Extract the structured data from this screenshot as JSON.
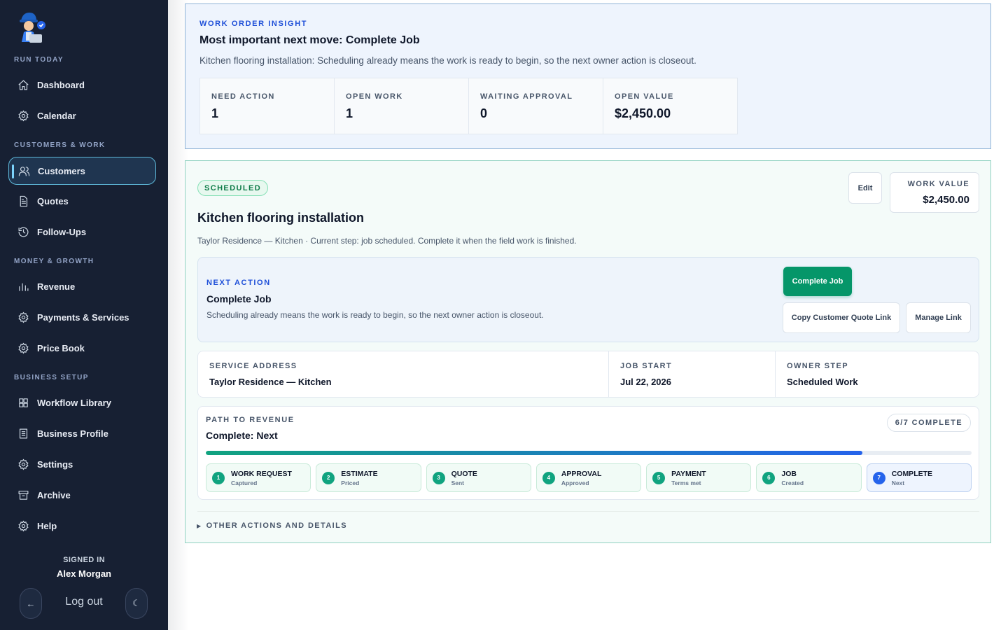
{
  "sidebar": {
    "sections": {
      "run_today": "RUN TODAY",
      "customers_work": "CUSTOMERS & WORK",
      "money_growth": "MONEY & GROWTH",
      "business_setup": "BUSINESS SETUP"
    },
    "items": [
      {
        "label": "Dashboard",
        "icon": "home-icon"
      },
      {
        "label": "Calendar",
        "icon": "gear-icon"
      },
      {
        "label": "Customers",
        "icon": "users-icon",
        "active": true
      },
      {
        "label": "Quotes",
        "icon": "document-icon"
      },
      {
        "label": "Follow-Ups",
        "icon": "history-icon"
      },
      {
        "label": "Revenue",
        "icon": "bar-chart-icon"
      },
      {
        "label": "Payments & Services",
        "icon": "gear-icon"
      },
      {
        "label": "Price Book",
        "icon": "gear-icon"
      },
      {
        "label": "Workflow Library",
        "icon": "grid-icon"
      },
      {
        "label": "Business Profile",
        "icon": "building-icon"
      },
      {
        "label": "Settings",
        "icon": "gear-icon"
      },
      {
        "label": "Archive",
        "icon": "archive-icon"
      },
      {
        "label": "Help",
        "icon": "gear-icon"
      }
    ],
    "signed_in_label": "SIGNED IN",
    "user_name": "Alex Morgan",
    "logout_label": "Log out",
    "back_icon": "←",
    "theme_icon": "☾"
  },
  "insight": {
    "eyebrow": "WORK ORDER INSIGHT",
    "headline": "Most important next move: Complete Job",
    "description": "Kitchen flooring installation: Scheduling already means the work is ready to begin, so the next owner action is closeout.",
    "stats": [
      {
        "label": "NEED ACTION",
        "value": "1"
      },
      {
        "label": "OPEN WORK",
        "value": "1"
      },
      {
        "label": "WAITING APPROVAL",
        "value": "0"
      },
      {
        "label": "OPEN VALUE",
        "value": "$2,450.00"
      }
    ]
  },
  "work": {
    "status_badge": "SCHEDULED",
    "edit_label": "Edit",
    "work_value_label": "WORK VALUE",
    "work_value": "$2,450.00",
    "title": "Kitchen flooring installation",
    "subtitle": "Taylor Residence — Kitchen · Current step: job scheduled. Complete it when the field work is finished.",
    "next_action": {
      "eyebrow": "NEXT ACTION",
      "title": "Complete Job",
      "description": "Scheduling already means the work is ready to begin, so the next owner action is closeout.",
      "primary_button": "Complete Job",
      "copy_link_button": "Copy Customer Quote Link",
      "manage_link_button": "Manage Link"
    },
    "info": [
      {
        "label": "SERVICE ADDRESS",
        "value": "Taylor Residence — Kitchen"
      },
      {
        "label": "JOB START",
        "value": "Jul 22, 2026"
      },
      {
        "label": "OWNER STEP",
        "value": "Scheduled Work"
      }
    ],
    "path": {
      "eyebrow": "PATH TO REVENUE",
      "title": "Complete: Next",
      "complete_pill": "6/7 COMPLETE",
      "progress_fraction": 0.857,
      "steps": [
        {
          "num": "1",
          "name": "WORK REQUEST",
          "status": "Captured"
        },
        {
          "num": "2",
          "name": "ESTIMATE",
          "status": "Priced"
        },
        {
          "num": "3",
          "name": "QUOTE",
          "status": "Sent"
        },
        {
          "num": "4",
          "name": "APPROVAL",
          "status": "Approved"
        },
        {
          "num": "5",
          "name": "PAYMENT",
          "status": "Terms met"
        },
        {
          "num": "6",
          "name": "JOB",
          "status": "Created"
        },
        {
          "num": "7",
          "name": "COMPLETE",
          "status": "Next",
          "current": true
        }
      ]
    },
    "other_actions_label": "OTHER ACTIONS AND DETAILS"
  },
  "colors": {
    "sidebar_bg": "#172033",
    "accent_green": "#059669",
    "accent_blue": "#1d4ed8"
  }
}
